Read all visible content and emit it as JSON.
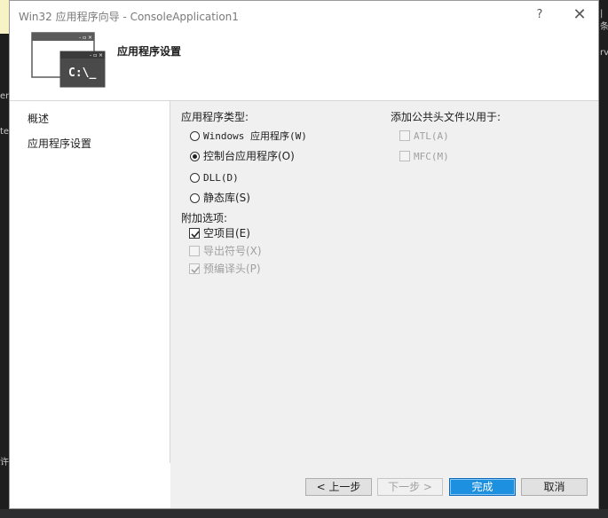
{
  "window": {
    "title": "Win32 应用程序向导 - ConsoleApplication1",
    "help_glyph": "?",
    "close_glyph": "✕"
  },
  "header": {
    "title": "应用程序设置",
    "icon_text": "C:\\_",
    "icon_window_controls": "- ▫ ×"
  },
  "nav": {
    "items": [
      {
        "label": "概述"
      },
      {
        "label": "应用程序设置"
      }
    ]
  },
  "app_type": {
    "heading": "应用程序类型:",
    "options": [
      {
        "label": "Windows 应用程序(W)",
        "selected": false
      },
      {
        "label": "控制台应用程序(O)",
        "selected": true
      },
      {
        "label": "DLL(D)",
        "selected": false
      },
      {
        "label": "静态库(S)",
        "selected": false
      }
    ]
  },
  "extra_options": {
    "heading": "附加选项:",
    "items": [
      {
        "label": "空项目(E)",
        "checked": true,
        "enabled": true
      },
      {
        "label": "导出符号(X)",
        "checked": false,
        "enabled": false
      },
      {
        "label": "预编译头(P)",
        "checked": true,
        "enabled": false
      }
    ]
  },
  "common_headers": {
    "heading": "添加公共头文件以用于:",
    "items": [
      {
        "label": "ATL(A)",
        "checked": false,
        "enabled": false
      },
      {
        "label": "MFC(M)",
        "checked": false,
        "enabled": false
      }
    ]
  },
  "buttons": {
    "prev": "< 上一步",
    "next": "下一步 >",
    "finish": "完成",
    "cancel": "取消"
  },
  "background": {
    "frag_right_top": "|条",
    "frag_right_2": "rv",
    "frag_left_1": "en",
    "frag_left_2": "te",
    "frag_left_bottom": "许号"
  },
  "colors": {
    "primary_button": "#1e90e0",
    "dialog_panel": "#f0f0f0",
    "disabled_text": "#a0a0a0"
  }
}
